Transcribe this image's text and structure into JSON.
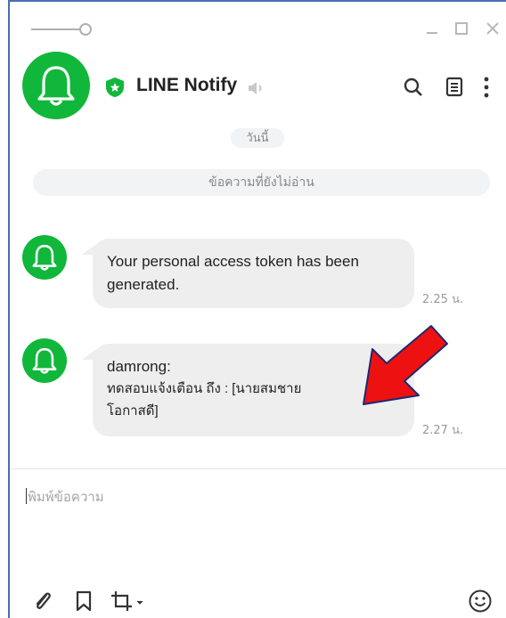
{
  "window": {
    "controls": [
      "minimize",
      "maximize",
      "close"
    ],
    "icons": {
      "pin": "pin-icon",
      "minimize": "minimize-icon",
      "maximize": "maximize-icon",
      "close": "close-icon"
    }
  },
  "header": {
    "title": "LINE Notify",
    "verified_color": "#11b73a",
    "icons": [
      "bell-icon",
      "shield-badge-icon",
      "speaker-icon",
      "search-icon",
      "notes-icon",
      "more-icon"
    ]
  },
  "chat": {
    "date_label": "วันนี้",
    "unread_label": "ข้อความที่ยังไม่อ่าน",
    "messages": [
      {
        "text": "Your personal access token has been\ngenerated.",
        "time": "2.25 น."
      },
      {
        "sender": "damrong:",
        "text": "ทดสอบแจ้งเตือน ถึง : [นายสมชาย\nโอกาสดี]",
        "time": "2.27 น."
      }
    ]
  },
  "composer": {
    "placeholder": "พิมพ์ข้อความ",
    "icons": [
      "attach-icon",
      "bookmark-icon",
      "crop-icon",
      "emoji-icon"
    ]
  },
  "annotation": {
    "arrow_color": "#ee1111"
  },
  "colors": {
    "accent": "#11b73a",
    "bubble": "#eeeeee",
    "border": "#4a6fb5"
  }
}
